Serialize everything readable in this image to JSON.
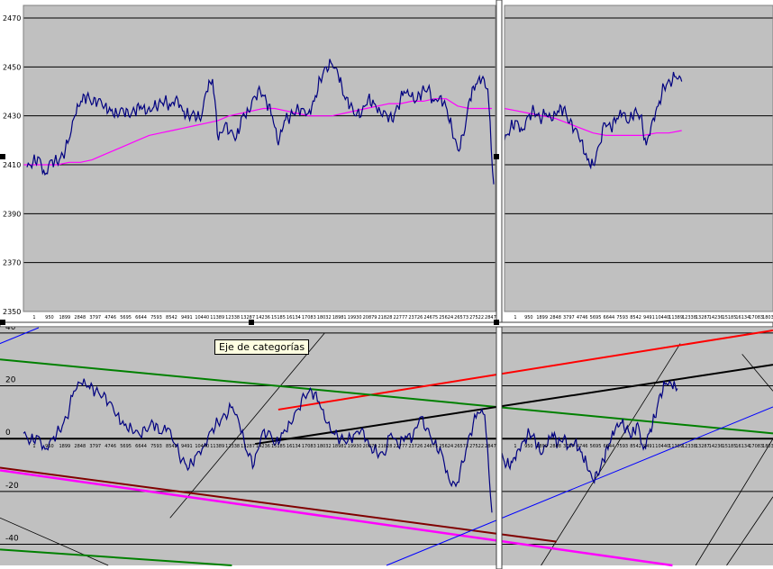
{
  "tooltip": "Eje de categorías",
  "colors": {
    "plot_bg": "#c0c0c0",
    "grid": "#000000",
    "price": "#000080",
    "average": "#ff00ff",
    "red_line": "#ff0000",
    "green_line": "#008000",
    "black_line": "#000000",
    "dark_red_line": "#800000",
    "magenta_line": "#ff00ff",
    "blue_line": "#0000ff",
    "diagonal": "#000000"
  },
  "chart_data": [
    {
      "type": "line",
      "panel": "top-left",
      "y_ticks": [
        "2470",
        "2450",
        "2430",
        "2410",
        "2390",
        "2370",
        "2350"
      ],
      "ylim": [
        2350,
        2475
      ],
      "x_tick_labels": [
        "1",
        "950",
        "1899",
        "2848",
        "3797",
        "4746",
        "5695",
        "6644",
        "7593",
        "8542",
        "9491",
        "10440",
        "11389",
        "12338",
        "13287",
        "14236",
        "15185",
        "16134",
        "17083",
        "18032",
        "18981",
        "19930",
        "20879",
        "21828",
        "22777",
        "23726",
        "24675",
        "25624",
        "26573",
        "27522",
        "28471"
      ],
      "series": [
        {
          "role": "price",
          "y": [
            2409,
            2411,
            2413,
            2406,
            2412,
            2411,
            2414,
            2420,
            2430,
            2436,
            2438,
            2435,
            2437,
            2434,
            2432,
            2431,
            2433,
            2430,
            2432,
            2434,
            2431,
            2433,
            2435,
            2436,
            2434,
            2438,
            2432,
            2430,
            2431,
            2428,
            2440,
            2445,
            2420,
            2426,
            2424,
            2421,
            2430,
            2432,
            2438,
            2440,
            2436,
            2430,
            2418,
            2428,
            2430,
            2432,
            2433,
            2431,
            2436,
            2445,
            2450,
            2451,
            2447,
            2438,
            2434,
            2430,
            2432,
            2437,
            2435,
            2432,
            2431,
            2428,
            2434,
            2440,
            2438,
            2436,
            2440,
            2441,
            2436,
            2438,
            2434,
            2425,
            2416,
            2422,
            2437,
            2443,
            2445,
            2441,
            2402
          ]
        },
        {
          "role": "average",
          "y": [
            2410,
            2410,
            2410,
            2410,
            2411,
            2411,
            2412,
            2414,
            2416,
            2418,
            2420,
            2422,
            2423,
            2424,
            2425,
            2426,
            2427,
            2428,
            2430,
            2431,
            2432,
            2433,
            2433,
            2432,
            2431,
            2430,
            2430,
            2430,
            2431,
            2432,
            2433,
            2434,
            2435,
            2435,
            2436,
            2436,
            2437,
            2437,
            2434,
            2433,
            2433,
            2433
          ]
        }
      ]
    },
    {
      "type": "line",
      "panel": "top-right",
      "ylim": [
        2350,
        2475
      ],
      "x_tick_labels": [
        "1",
        "950",
        "1899",
        "2848",
        "3797",
        "4746",
        "5695",
        "6644",
        "7593",
        "8542",
        "9491",
        "10440",
        "11389",
        "12338",
        "13287",
        "14236",
        "15185",
        "16134",
        "17083",
        "18032"
      ],
      "series": [
        {
          "role": "price",
          "y": [
            2420,
            2425,
            2428,
            2424,
            2430,
            2432,
            2429,
            2431,
            2428,
            2432,
            2433,
            2427,
            2425,
            2420,
            2412,
            2410,
            2418,
            2427,
            2425,
            2429,
            2431,
            2427,
            2432,
            2430,
            2418,
            2428,
            2434,
            2442,
            2444,
            2446,
            2444
          ]
        },
        {
          "role": "average",
          "y": [
            2433,
            2432,
            2431,
            2430,
            2429,
            2427,
            2425,
            2423,
            2422,
            2422,
            2422,
            2422,
            2423,
            2423,
            2424
          ]
        }
      ]
    },
    {
      "type": "line",
      "panel": "bottom",
      "y_ticks": [
        "40",
        "20",
        "0",
        "-20",
        "-40"
      ],
      "ylim": [
        -48,
        42
      ],
      "x_tick_labels": [
        "1",
        "950",
        "1899",
        "2848",
        "3797",
        "4746",
        "5695",
        "6644",
        "7593",
        "8542",
        "9491",
        "10440",
        "11389",
        "12338",
        "13287",
        "14236",
        "15185",
        "16134",
        "17083",
        "18032",
        "18981",
        "19930",
        "20879",
        "21828",
        "22777",
        "23726",
        "24675",
        "25624",
        "26573",
        "27522",
        "28471"
      ],
      "x_tick_labels_right": [
        "1",
        "950",
        "1899",
        "2848",
        "3797",
        "4746",
        "5695",
        "6644",
        "7593",
        "8542",
        "9491",
        "10440",
        "11389",
        "12338",
        "13287",
        "14236",
        "15185",
        "16134",
        "17083",
        "18032"
      ],
      "series": [
        {
          "role": "oscillator",
          "y": [
            2,
            -1,
            1,
            -4,
            0,
            3,
            8,
            18,
            21,
            20,
            18,
            16,
            14,
            9,
            5,
            4,
            2,
            3,
            6,
            2,
            4,
            -2,
            -8,
            -11,
            -6,
            -3,
            3,
            6,
            9,
            12,
            5,
            -5,
            -10,
            1,
            3,
            -2,
            2,
            6,
            11,
            16,
            18,
            14,
            6,
            2,
            0,
            -1,
            2,
            4,
            -3,
            -5,
            -6,
            2,
            -3,
            1,
            0,
            8,
            4,
            -2,
            -5,
            -15,
            -18,
            -9,
            2,
            10,
            9,
            -28
          ]
        },
        {
          "role": "oscillator",
          "y": [
            -6,
            -10,
            -9,
            -4,
            -1,
            2,
            0,
            -6,
            -3,
            2,
            -2,
            0,
            -3,
            -1,
            -5,
            -9,
            -15,
            -14,
            -8,
            -2,
            3,
            6,
            4,
            1,
            6,
            -4,
            2,
            8,
            17,
            21,
            20,
            19
          ]
        }
      ],
      "trend_lines": [
        {
          "color": "red",
          "from": [
            0.36,
            11
          ],
          "to": [
            1.0,
            41
          ]
        },
        {
          "color": "green",
          "from": [
            0.0,
            30
          ],
          "to": [
            1.0,
            2
          ]
        },
        {
          "color": "black",
          "from": [
            0.33,
            -2
          ],
          "to": [
            1.0,
            28
          ]
        },
        {
          "color": "black",
          "from": [
            0.0,
            0
          ],
          "to": [
            0.645,
            0
          ]
        },
        {
          "color": "black",
          "from": [
            0.65,
            0
          ],
          "to": [
            1.0,
            0
          ]
        },
        {
          "color": "dark-red",
          "from": [
            0.0,
            -11
          ],
          "to": [
            0.72,
            -39
          ]
        },
        {
          "color": "magenta",
          "from": [
            0.0,
            -12
          ],
          "to": [
            0.87,
            -48
          ]
        },
        {
          "color": "green",
          "from": [
            0.0,
            -42
          ],
          "to": [
            0.3,
            -48
          ]
        },
        {
          "color": "blue",
          "from": [
            0.5,
            -48
          ],
          "to": [
            1.0,
            12
          ]
        },
        {
          "color": "blue",
          "from": [
            0.0,
            36
          ],
          "to": [
            0.05,
            42
          ]
        }
      ],
      "diagonals": [
        {
          "from": [
            0.22,
            -30
          ],
          "to": [
            0.42,
            40
          ]
        },
        {
          "from": [
            0.0,
            -30
          ],
          "to": [
            0.14,
            -48
          ]
        },
        {
          "from": [
            0.7,
            -48
          ],
          "to": [
            0.88,
            36
          ]
        },
        {
          "from": [
            0.94,
            -48
          ],
          "to": [
            1.0,
            -22
          ]
        },
        {
          "from": [
            0.96,
            32
          ],
          "to": [
            1.0,
            18
          ]
        },
        {
          "from": [
            0.9,
            -48
          ],
          "to": [
            1.0,
            0
          ]
        }
      ]
    }
  ]
}
